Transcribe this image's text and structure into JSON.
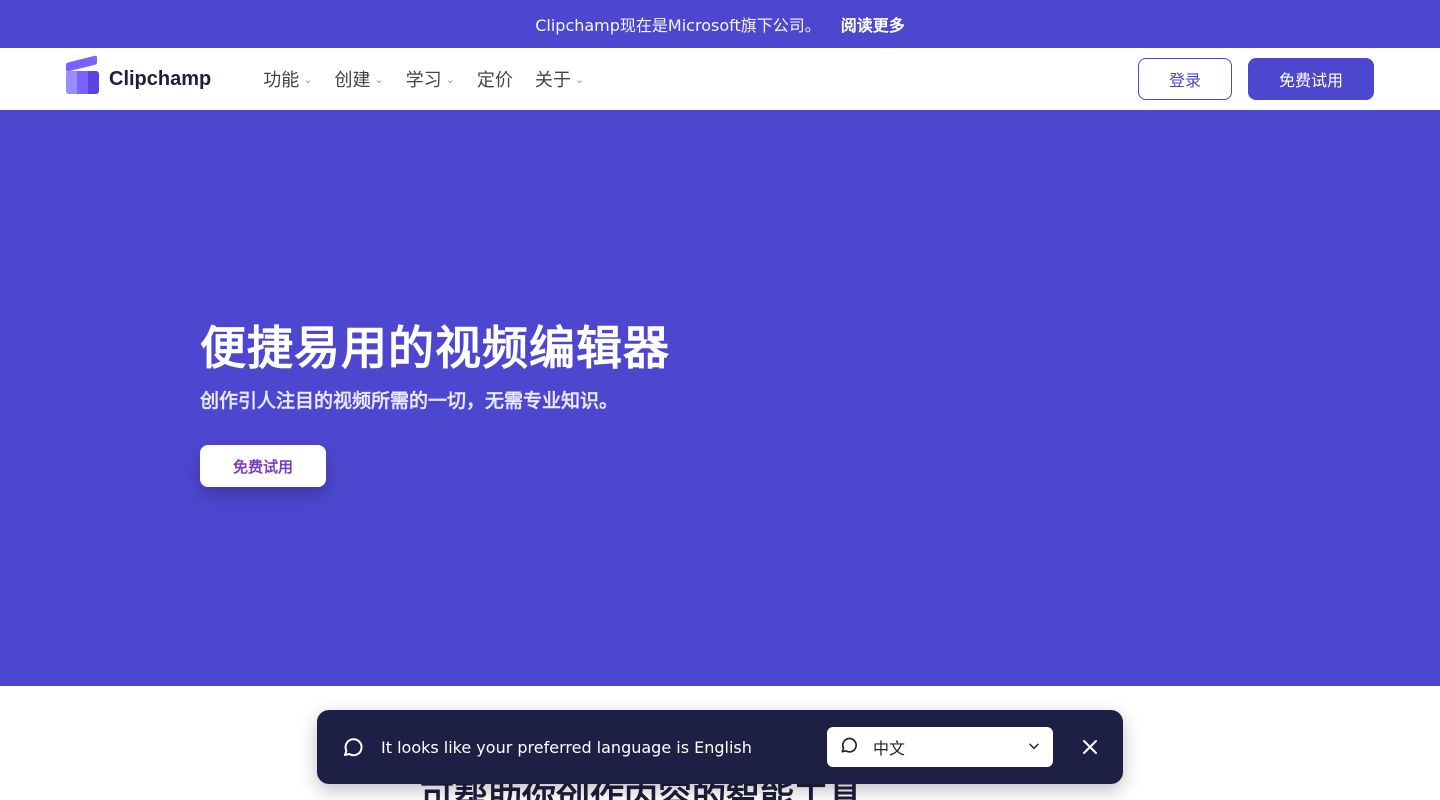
{
  "announcement": {
    "message": "Clipchamp现在是Microsoft旗下公司。",
    "read_more": "阅读更多"
  },
  "nav": {
    "brand": "Clipchamp",
    "menu": [
      {
        "label": "功能",
        "has_dropdown": true
      },
      {
        "label": "创建",
        "has_dropdown": true
      },
      {
        "label": "学习",
        "has_dropdown": true
      },
      {
        "label": "定价",
        "has_dropdown": false
      },
      {
        "label": "关于",
        "has_dropdown": true
      }
    ],
    "login": "登录",
    "free_trial": "免费试用"
  },
  "hero": {
    "title": "便捷易用的视频编辑器",
    "subtitle": "创作引人注目的视频所需的一切，无需专业知识。",
    "cta": "免费试用"
  },
  "below": {
    "heading": "可帮助你创作内容的智能工具"
  },
  "language_banner": {
    "message": "It looks like your preferred language is English",
    "selected_language": "中文"
  },
  "colors": {
    "brand": "#4d47d0",
    "banner_bg": "#1e1f45",
    "cta_text": "#7a3fc4"
  },
  "icons": [
    "chevron-down-icon",
    "chat-bubble-icon",
    "close-icon"
  ]
}
